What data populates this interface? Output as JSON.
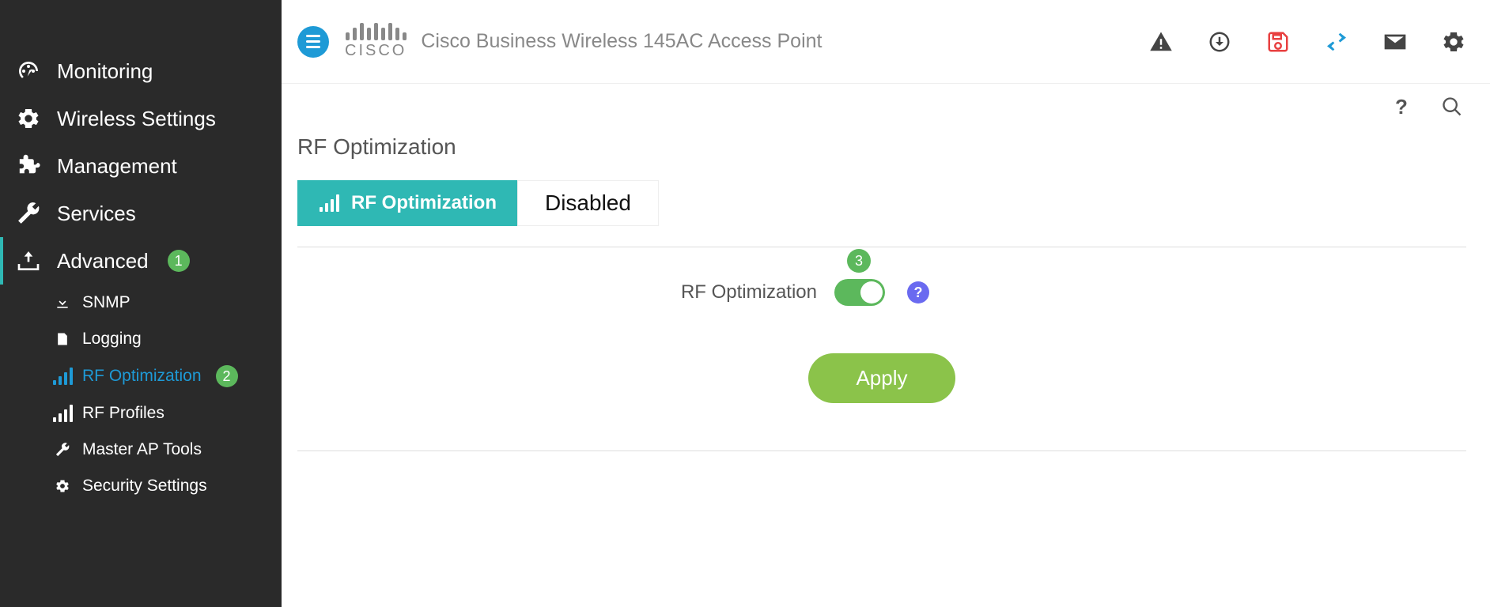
{
  "header": {
    "logo_word": "cisco",
    "product_title": "Cisco Business Wireless 145AC Access Point"
  },
  "sidebar": {
    "items": [
      {
        "label": "Monitoring"
      },
      {
        "label": "Wireless Settings"
      },
      {
        "label": "Management"
      },
      {
        "label": "Services"
      },
      {
        "label": "Advanced",
        "badge": "1"
      }
    ],
    "advanced_sub": [
      {
        "label": "SNMP"
      },
      {
        "label": "Logging"
      },
      {
        "label": "RF Optimization",
        "badge": "2",
        "active": true
      },
      {
        "label": "RF Profiles"
      },
      {
        "label": "Master AP Tools"
      },
      {
        "label": "Security Settings"
      }
    ]
  },
  "page": {
    "title": "RF Optimization",
    "tab_label": "RF Optimization",
    "status": "Disabled",
    "form_label": "RF Optimization",
    "toggle_badge": "3",
    "help_symbol": "?",
    "apply_label": "Apply"
  },
  "secondbar": {
    "help_symbol": "?"
  }
}
